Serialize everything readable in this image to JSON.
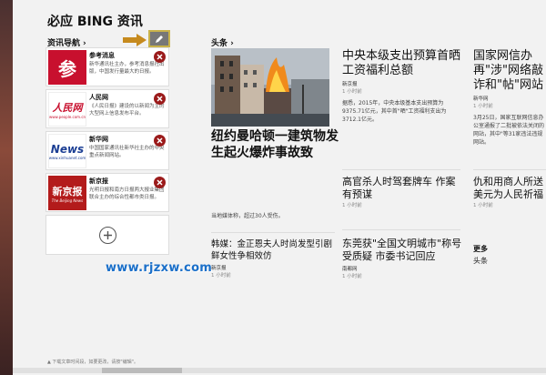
{
  "app": {
    "title": "必应 BING 资讯"
  },
  "nav": {
    "label": "资讯导航",
    "chevron": "›",
    "sources": [
      {
        "name": "参考消息",
        "desc": "新华通讯社主办，参考消息报社出版，中国发行量最大的日报。",
        "logo_text": "参",
        "logo_bg": "#c8102e"
      },
      {
        "name": "人民网",
        "desc": "《人民日报》建设的以新闻为主的大型网上信息发布平台。",
        "logo_text": "人民网",
        "logo_sub": "www.people.com.cn",
        "logo_bg": "#ffffff"
      },
      {
        "name": "新华网",
        "desc": "中国国家通讯社新华社主办的中央重点新闻网站。",
        "logo_text": "News",
        "logo_sub": "www.xinhuanet.com",
        "logo_bg": "#ffffff"
      },
      {
        "name": "新京报",
        "desc": "光明日报和南方日报两大报业集团联合主办的综合性都市类日报。",
        "logo_text": "新京报",
        "logo_sub": "The Beijing News",
        "logo_bg": "#b31b1b"
      }
    ]
  },
  "watermark": "www.rjzxw.com",
  "footer": "▲ 下载文章时间段，如要更改，请按\"编辑\"。",
  "headlines": {
    "label": "头条",
    "chevron": "›",
    "hero": {
      "title": "纽约曼哈顿一建筑物发生起火爆炸事故致"
    },
    "articles": [
      {
        "id": "a1",
        "title": "中央本级支出预算首晒工资福利总额",
        "source": "新京报",
        "time": "1 小时前",
        "summary": "据悉，2015年，中央本级基本支出预算为9375.71亿元，其中首\"晒\"工资福利支出为3712.1亿元。"
      },
      {
        "id": "a2",
        "title": "国家网信办再\"涉\"网络敲诈和\"帖\"网站",
        "source": "新华网",
        "time": "1 小时前",
        "summary": "3月25日，国家互联网信息办公室通报了二批被依法关闭的网站，其中\"等31家违法违规网站。"
      },
      {
        "id": "a3",
        "title": "高官杀人时驾套牌车 作案有预谋",
        "source": "",
        "time": "1 小时前",
        "summary": ""
      },
      {
        "id": "a4",
        "title": "仇和用商人所送美元为人民祈福",
        "source": "",
        "time": "1 小时前",
        "summary": ""
      },
      {
        "id": "a5",
        "title": "韩媒：金正恩夫人时尚发型引剧鲜女性争相效仿",
        "source": "新京报",
        "time": "1 小时前",
        "summary": ""
      },
      {
        "id": "a6",
        "title": "东莞获\"全国文明城市\"称号受质疑 市委书记回应",
        "source": "南都网",
        "time": "1 小时前",
        "summary": ""
      }
    ],
    "hero_sub": "当地媒体称，超过30人受伤。",
    "more": {
      "label": "更多",
      "item": "头条"
    }
  }
}
